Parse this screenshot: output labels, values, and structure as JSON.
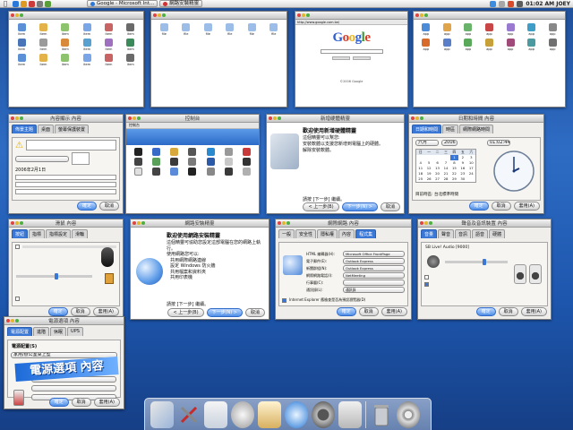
{
  "menubar": {
    "tasks": [
      {
        "label": "Google - Microsoft Int...",
        "icon": "ie-icon"
      },
      {
        "label": "網路安裝精靈",
        "icon": "wizard-icon"
      }
    ],
    "clock": "01:02 AM JOEY"
  },
  "thumbs": {
    "google": {
      "logo": "Google",
      "address": "http://www.google.com.tw/",
      "footer": "©2006 Google"
    }
  },
  "win_display": {
    "title": "內容顯示 內容",
    "tabs": [
      "佈景主題",
      "桌面",
      "螢幕保護裝置",
      "外觀",
      "設定值"
    ],
    "date_label": "2006年2月1日"
  },
  "win_control": {
    "title": "控制台",
    "address": "控制台"
  },
  "win_wizard_top": {
    "title": "新增硬體精靈",
    "heading": "歡迎使用新增硬體精靈",
    "lines": [
      "這個精靈可以幫您:",
      "安裝軟體以支援您新增到電腦上的硬體。",
      "解除安裝軟體。"
    ],
    "next_hint": "請按 [下一步] 繼續。",
    "buttons": {
      "back": "< 上一步(B)",
      "next": "下一步(N) >",
      "cancel": "取消"
    }
  },
  "win_datetime": {
    "title": "日期和時間 內容",
    "tabs": [
      "日期和時間",
      "時區",
      "網際網路時間"
    ],
    "month": "六月",
    "year": "2006",
    "time": "01:02:44",
    "tz": "目前時區: 台北標準時間",
    "days_header": [
      "日",
      "一",
      "二",
      "三",
      "四",
      "五",
      "六"
    ],
    "days": [
      "",
      "",
      "",
      "",
      "1",
      "2",
      "3",
      "4",
      "5",
      "6",
      "7",
      "8",
      "9",
      "10",
      "11",
      "12",
      "13",
      "14",
      "15",
      "16",
      "17",
      "18",
      "19",
      "20",
      "21",
      "22",
      "23",
      "24",
      "25",
      "26",
      "27",
      "28",
      "29",
      "30"
    ],
    "buttons": {
      "ok": "確定",
      "cancel": "取消",
      "apply": "套用(A)"
    }
  },
  "win_mouse": {
    "title": "滑鼠 內容",
    "tabs": [
      "按鈕",
      "指標",
      "指標設定",
      "滑輪",
      "硬體"
    ],
    "buttons": {
      "ok": "確定",
      "cancel": "取消",
      "apply": "套用(A)"
    }
  },
  "win_netwizard": {
    "title": "網路安裝精靈",
    "heading": "歡迎使用網路安裝精靈",
    "lines": [
      "這個精靈可協助您設定這部電腦在您的網路上執行。",
      "使用網路您可以:",
      "共用網際網路連線",
      "設定 Windows 防火牆",
      "共用檔案和資料夾",
      "共用印表機"
    ],
    "next_hint": "請按 [下一步] 繼續。",
    "buttons": {
      "back": "< 上一步(B)",
      "next": "下一步(N) >",
      "cancel": "取消"
    }
  },
  "win_internet": {
    "title": "網際網路 內容",
    "tabs": [
      "一般",
      "安全性",
      "隱私權",
      "內容",
      "連線",
      "程式集",
      "進階"
    ],
    "rows": [
      {
        "label": "HTML 編輯器(H):",
        "value": "Microsoft Office FrontPage"
      },
      {
        "label": "電子郵件(E):",
        "value": "Outlook Express"
      },
      {
        "label": "新聞群組(N):",
        "value": "Outlook Express"
      },
      {
        "label": "網際網路電話(I):",
        "value": "NetMeeting"
      },
      {
        "label": "行事曆(C):",
        "value": ""
      },
      {
        "label": "通訊錄(L):",
        "value": "通訊錄"
      }
    ],
    "check": "Internet Explorer 應檢查是否為預設瀏覽器(D)",
    "buttons": {
      "ok": "確定",
      "cancel": "取消",
      "apply": "套用(A)"
    }
  },
  "win_sound": {
    "title": "聲音及音訊裝置 內容",
    "tabs": [
      "音量",
      "聲音",
      "音訊",
      "語音",
      "硬體"
    ],
    "device": "SB Live! Audio [9000]",
    "buttons": {
      "ok": "確定",
      "cancel": "取消",
      "apply": "套用(A)"
    }
  },
  "win_power": {
    "title": "電源選項 內容",
    "tabs": [
      "電源配置",
      "進階",
      "休眠",
      "UPS"
    ],
    "scheme_label": "電源配置(S)",
    "scheme": "家用/辦公室桌上型",
    "overlay": "電源選項 內容",
    "buttons": {
      "ok": "確定",
      "cancel": "取消",
      "apply": "套用(A)"
    }
  }
}
